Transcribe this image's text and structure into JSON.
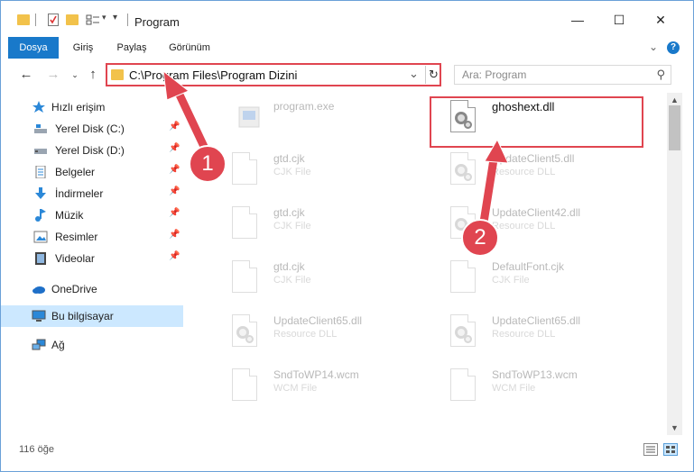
{
  "window": {
    "title": "Program",
    "controls": {
      "minimize": "—",
      "maximize": "☐",
      "close": "✕"
    }
  },
  "ribbon": {
    "tabs": [
      "Dosya",
      "Giriş",
      "Paylaş",
      "Görünüm"
    ],
    "active_tab": "Dosya",
    "help": "?"
  },
  "address": {
    "path": "C:\\Program Files\\Program Dizini",
    "search_placeholder": "Ara: Program"
  },
  "sidebar": {
    "items": [
      {
        "label": "Hızlı erişim",
        "icon": "star-icon",
        "pinned": false
      },
      {
        "label": "Yerel Disk (C:)",
        "icon": "drive-icon",
        "pinned": true
      },
      {
        "label": "Yerel Disk (D:)",
        "icon": "drive-icon",
        "pinned": true
      },
      {
        "label": "Belgeler",
        "icon": "documents-icon",
        "pinned": true
      },
      {
        "label": "İndirmeler",
        "icon": "download-icon",
        "pinned": true
      },
      {
        "label": "Müzik",
        "icon": "music-icon",
        "pinned": true
      },
      {
        "label": "Resimler",
        "icon": "pictures-icon",
        "pinned": true
      },
      {
        "label": "Videolar",
        "icon": "video-icon",
        "pinned": true
      },
      {
        "label": "OneDrive",
        "icon": "cloud-icon",
        "pinned": false
      },
      {
        "label": "Bu bilgisayar",
        "icon": "computer-icon",
        "pinned": false,
        "selected": true
      },
      {
        "label": "Ağ",
        "icon": "network-icon",
        "pinned": false
      }
    ]
  },
  "files": [
    {
      "name": "program.exe",
      "type": "",
      "icon": "exe-icon",
      "faded": true
    },
    {
      "name": "ghoshext.dll",
      "type": "",
      "icon": "dll-icon",
      "faded": false,
      "highlighted": true
    },
    {
      "name": "gtd.cjk",
      "type": "CJK File",
      "icon": "file-icon",
      "faded": true
    },
    {
      "name": "UpdateClient5.dll",
      "type": "Resource DLL",
      "icon": "dll-icon",
      "faded": true
    },
    {
      "name": "gtd.cjk",
      "type": "CJK File",
      "icon": "file-icon",
      "faded": true
    },
    {
      "name": "UpdateClient42.dll",
      "type": "Resource DLL",
      "icon": "dll-icon",
      "faded": true
    },
    {
      "name": "gtd.cjk",
      "type": "CJK File",
      "icon": "file-icon",
      "faded": true
    },
    {
      "name": "DefaultFont.cjk",
      "type": "CJK File",
      "icon": "file-icon",
      "faded": true
    },
    {
      "name": "UpdateClient65.dll",
      "type": "Resource DLL",
      "icon": "dll-icon",
      "faded": true
    },
    {
      "name": "UpdateClient65.dll",
      "type": "Resource DLL",
      "icon": "dll-icon",
      "faded": true
    },
    {
      "name": "SndToWP14.wcm",
      "type": "WCM File",
      "icon": "file-icon",
      "faded": true
    },
    {
      "name": "SndToWP13.wcm",
      "type": "WCM File",
      "icon": "file-icon",
      "faded": true
    }
  ],
  "status": {
    "count": "116 öğe"
  },
  "annotations": {
    "step1": "1",
    "step2": "2",
    "color": "#e04550"
  }
}
